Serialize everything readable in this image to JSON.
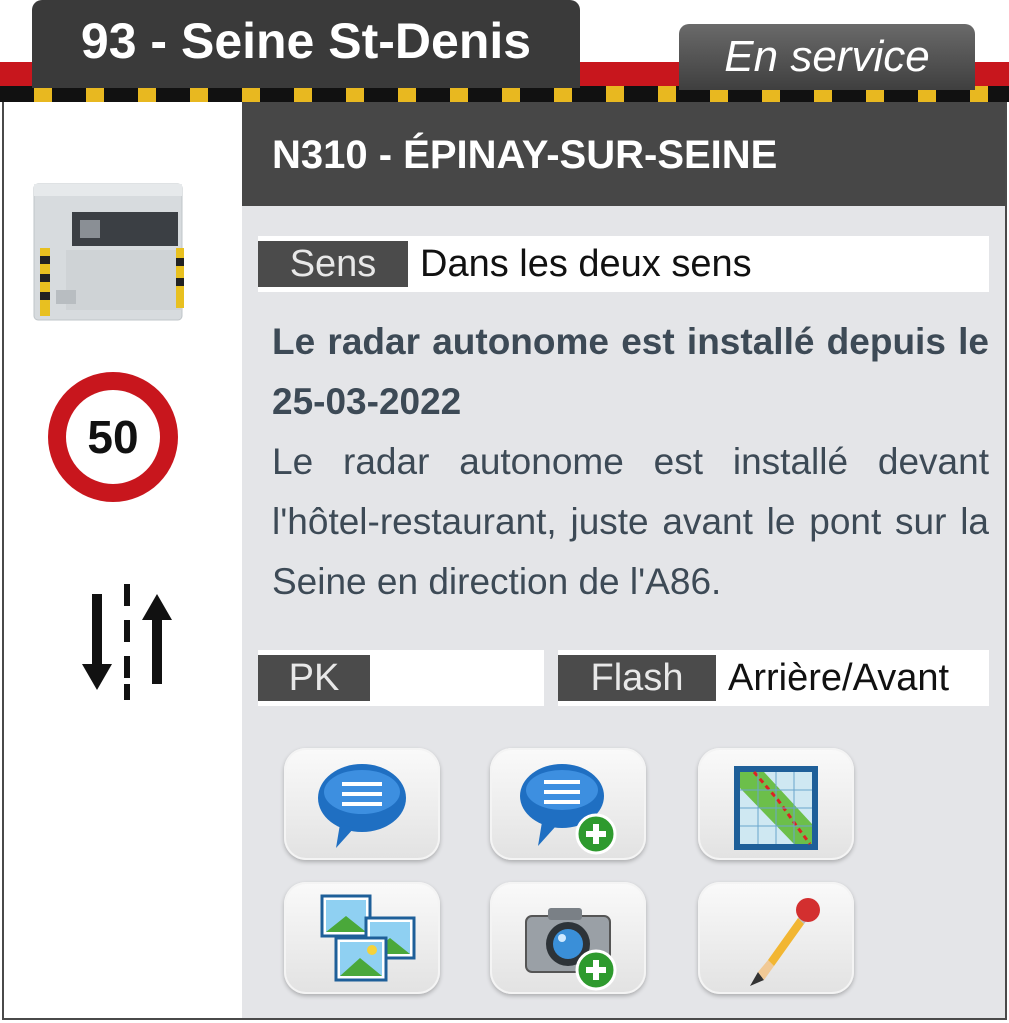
{
  "header": {
    "department": "93 - Seine St-Denis",
    "status": "En service"
  },
  "radar": {
    "location_title": "N310 - ÉPINAY-SUR-SEINE",
    "speed_limit": "50",
    "sens_label": "Sens",
    "sens_value": "Dans les deux sens",
    "description_bold": "Le radar autonome est installé depuis le 25-03-2022",
    "description_text": "Le radar autonome est installé devant l'hôtel-restaurant, juste avant le pont sur la Seine en direction de l'A86.",
    "pk_label": "PK",
    "pk_value": "",
    "flash_label": "Flash",
    "flash_value": "Arrière/Avant"
  },
  "actions": [
    {
      "icon": "comments-icon"
    },
    {
      "icon": "add-comment-icon"
    },
    {
      "icon": "map-icon"
    },
    {
      "icon": "photos-icon"
    },
    {
      "icon": "add-photo-icon"
    },
    {
      "icon": "edit-pencil-icon"
    }
  ],
  "colors": {
    "accent_red": "#c8161d",
    "dark_tab": "#3a3a3a",
    "panel_bg": "#e4e5e8"
  }
}
